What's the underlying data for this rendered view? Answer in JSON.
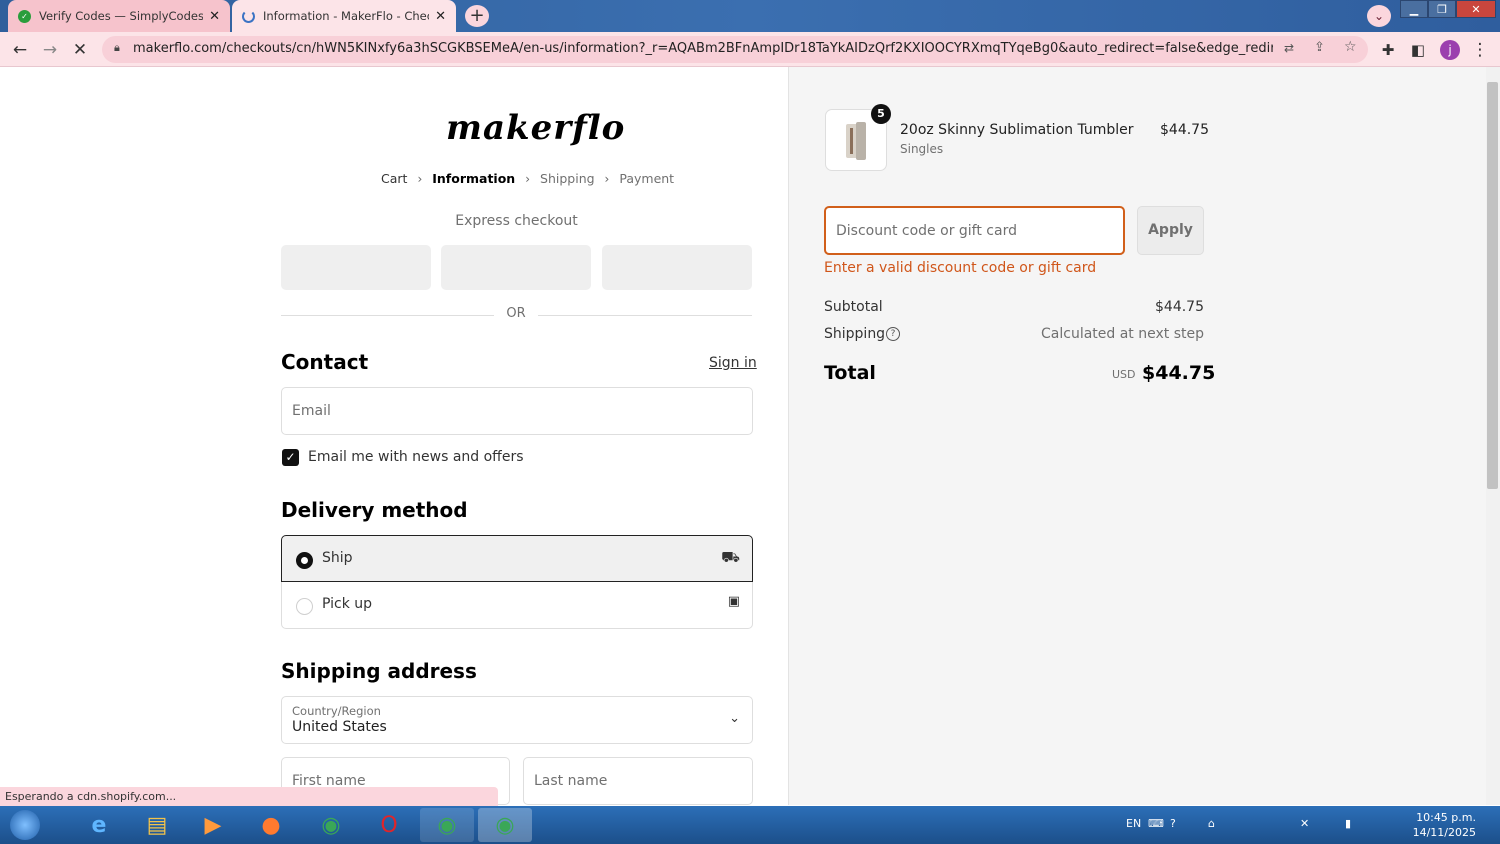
{
  "browser": {
    "tabs": [
      {
        "title": "Verify Codes — SimplyCodes",
        "close": "✕"
      },
      {
        "title": "Information - MakerFlo - Checkout",
        "close": "✕"
      }
    ],
    "new_tab": "+",
    "url": "makerflo.com/checkouts/cn/hWN5KINxfy6a3hSCGKBSEMeA/en-us/information?_r=AQABm2BFnAmpIDr18TaYkAIDzQrf2KXIOOCYRXmqTYqeBg0&auto_redirect=false&edge_redirect=true&skip_sh...",
    "avatar": "j",
    "status": "Esperando a cdn.shopify.com..."
  },
  "checkout": {
    "logo": "makerflo",
    "breadcrumbs": [
      "Cart",
      "Information",
      "Shipping",
      "Payment"
    ],
    "express_checkout": "Express checkout",
    "or": "OR",
    "contact": {
      "title": "Contact",
      "signin": "Sign in",
      "email_placeholder": "Email",
      "newsletter": "Email me with news and offers",
      "newsletter_checked": true
    },
    "delivery": {
      "title": "Delivery method",
      "ship": "Ship",
      "pickup": "Pick up",
      "selected": "Ship"
    },
    "shipping_address": {
      "title": "Shipping address",
      "country_label": "Country/Region",
      "country_value": "United States",
      "first_name_placeholder": "First name",
      "last_name_placeholder": "Last name"
    }
  },
  "order_summary": {
    "product": {
      "quantity": "5",
      "name": "20oz Skinny Sublimation Tumbler",
      "variant": "Singles",
      "price": "$44.75"
    },
    "discount_placeholder": "Discount code or gift card",
    "apply": "Apply",
    "discount_error": "Enter a valid discount code or gift card",
    "subtotal_label": "Subtotal",
    "subtotal_value": "$44.75",
    "shipping_label": "Shipping",
    "shipping_value": "Calculated at next step",
    "total_label": "Total",
    "currency": "USD",
    "total_value": "$44.75"
  },
  "taskbar": {
    "language": "EN",
    "time": "10:45 p.m.",
    "date": "14/11/2025"
  },
  "colors": {
    "accent_error": "#d0561a",
    "tab_pink": "#fbd6dd",
    "taskbar_blue": "#1c4f8a"
  }
}
